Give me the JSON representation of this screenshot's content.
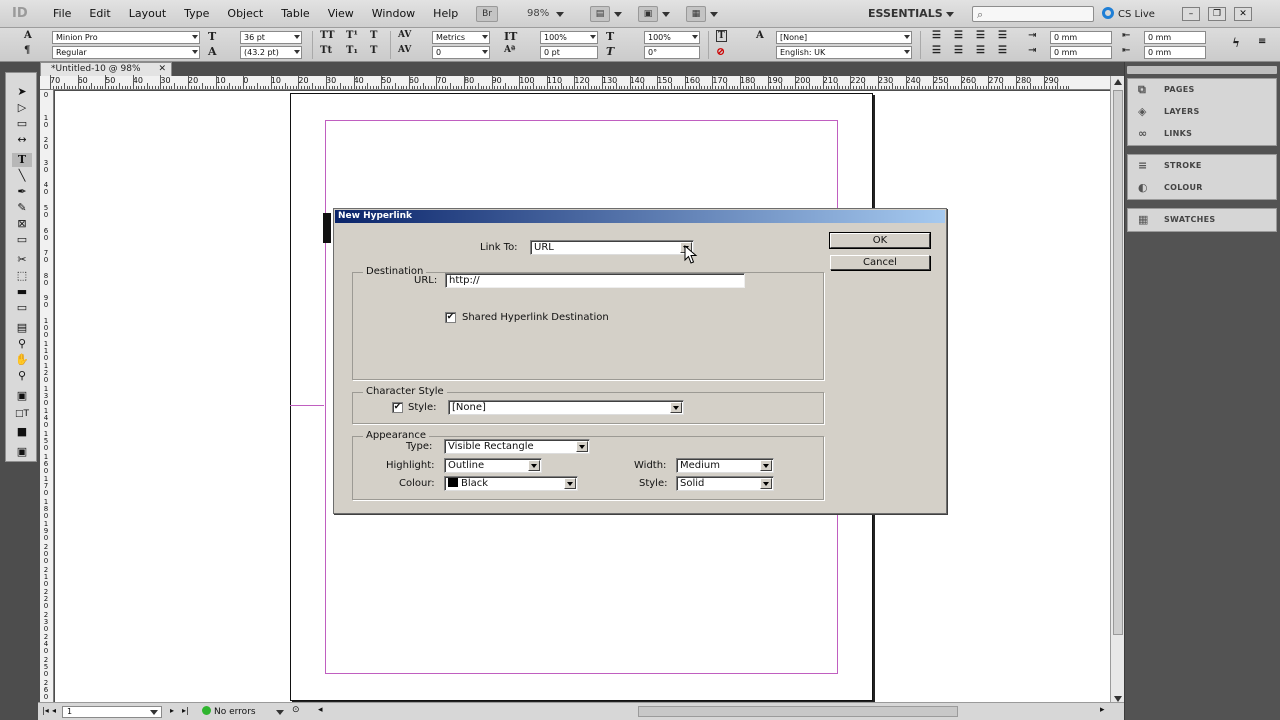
{
  "app": {
    "logo": "ID",
    "menus": [
      "File",
      "Edit",
      "Layout",
      "Type",
      "Object",
      "Table",
      "View",
      "Window",
      "Help"
    ],
    "bridge_label": "Br",
    "zoom": "98%",
    "workspace": "ESSENTIALS",
    "cs_live": "CS Live"
  },
  "control": {
    "font_family": "Minion Pro",
    "font_style": "Regular",
    "font_size": "36 pt",
    "leading": "(43.2 pt)",
    "kerning": "Metrics",
    "tracking": "0",
    "vscale": "100%",
    "baseline": "0 pt",
    "hscale": "100%",
    "skew": "0°",
    "char_style": "[None]",
    "language": "English: UK",
    "indent_left": "0 mm",
    "indent_first": "0 mm",
    "indent_right": "0 mm",
    "indent_last": "0 mm"
  },
  "document": {
    "tab_title": "*Untitled-10 @ 98%",
    "ruler_top": [
      "70",
      "60",
      "50",
      "40",
      "30",
      "20",
      "10",
      "0",
      "10",
      "20",
      "30",
      "40",
      "50",
      "60",
      "70",
      "80",
      "90",
      "100",
      "110",
      "120",
      "130",
      "140",
      "150",
      "160",
      "170",
      "180",
      "190",
      "200",
      "210",
      "220",
      "230",
      "240",
      "250",
      "260",
      "270",
      "280",
      "290"
    ],
    "ruler_left": [
      "0",
      "1\n0",
      "2\n0",
      "3\n0",
      "4\n0",
      "5\n0",
      "6\n0",
      "7\n0",
      "8\n0",
      "9\n0",
      "1\n0\n0",
      "1\n1\n0",
      "1\n2\n0",
      "1\n3\n0",
      "1\n4\n0",
      "1\n5\n0",
      "1\n6\n0",
      "1\n7\n0",
      "1\n8\n0",
      "1\n9\n0",
      "2\n0\n0",
      "2\n1\n0",
      "2\n2\n0",
      "2\n3\n0",
      "2\n4\n0",
      "2\n5\n0",
      "2\n6\n0"
    ]
  },
  "status": {
    "page": "1",
    "preflight": "No errors"
  },
  "panels": {
    "group1": [
      "PAGES",
      "LAYERS",
      "LINKS"
    ],
    "group2": [
      "STROKE",
      "COLOUR"
    ],
    "group3": [
      "SWATCHES"
    ]
  },
  "dialog": {
    "title": "New Hyperlink",
    "link_to_label": "Link To:",
    "link_to_value": "URL",
    "ok": "OK",
    "cancel": "Cancel",
    "destination": {
      "legend": "Destination",
      "url_label": "URL:",
      "url_value": "http://",
      "shared_label": "Shared Hyperlink Destination",
      "shared_checked": true
    },
    "character_style": {
      "legend": "Character Style",
      "style_label": "Style:",
      "style_value": "[None]",
      "style_checked": true
    },
    "appearance": {
      "legend": "Appearance",
      "type_label": "Type:",
      "type_value": "Visible Rectangle",
      "highlight_label": "Highlight:",
      "highlight_value": "Outline",
      "colour_label": "Colour:",
      "colour_value": "Black",
      "width_label": "Width:",
      "width_value": "Medium",
      "style_label": "Style:",
      "style_value": "Solid"
    }
  }
}
